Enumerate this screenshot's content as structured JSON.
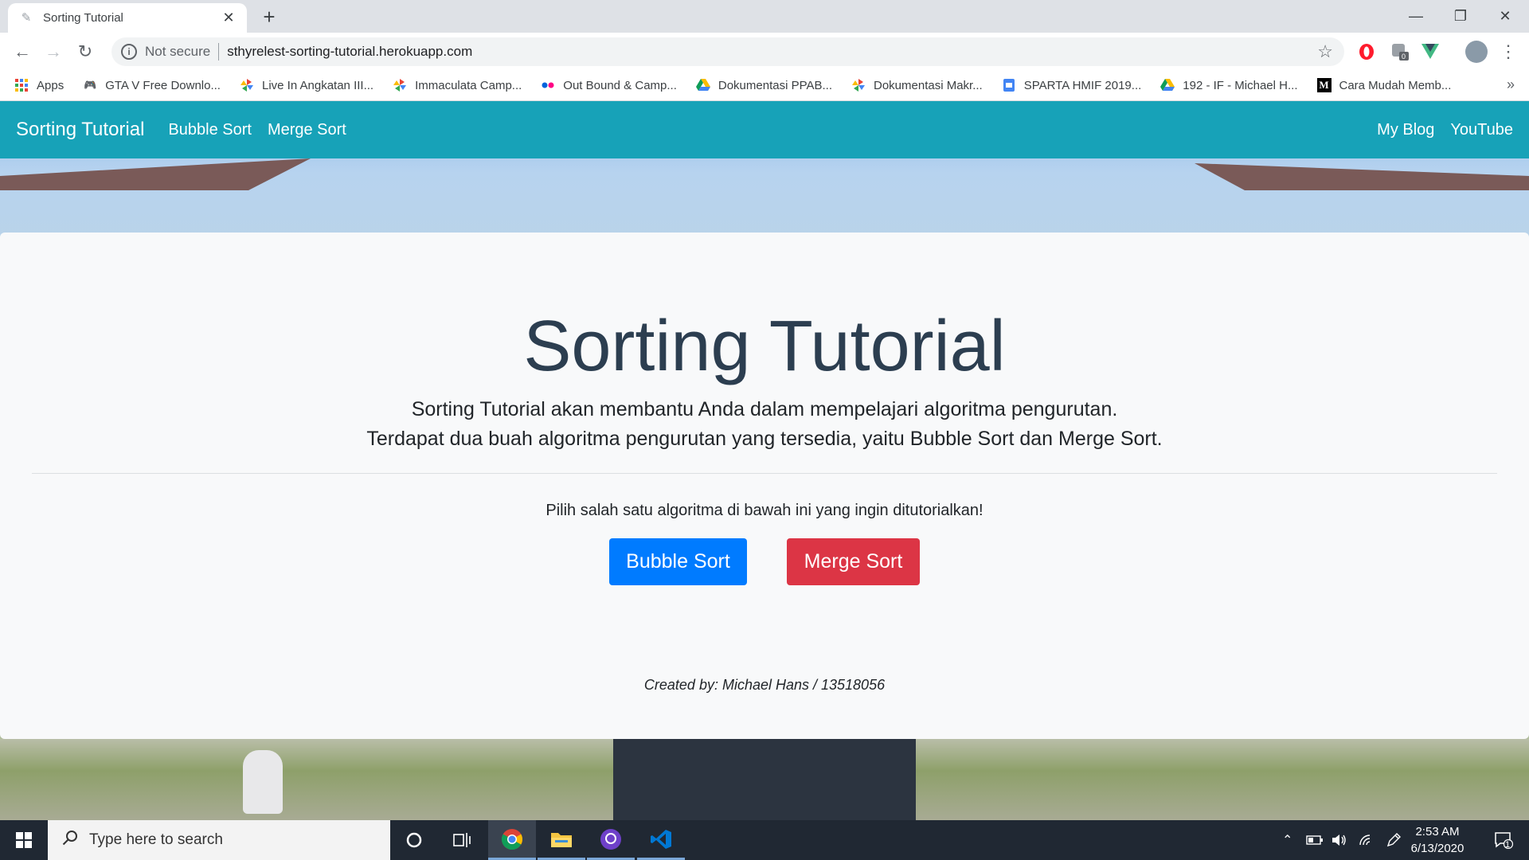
{
  "browser": {
    "tab": {
      "title": "Sorting Tutorial",
      "close": "✕"
    },
    "new_tab": "+",
    "window_controls": {
      "minimize": "—",
      "restore": "❐",
      "close": "✕"
    },
    "toolbar": {
      "back": "←",
      "forward": "→",
      "reload": "↻",
      "info_icon": "i",
      "security_label": "Not secure",
      "url": "sthyrelest-sorting-tutorial.herokuapp.com",
      "bookmark_star": "☆",
      "menu": "⋮"
    },
    "bookmarks": [
      {
        "label": "Apps",
        "icon": "apps-grid-icon",
        "color": "#1a73e8"
      },
      {
        "label": "GTA V Free Downlo...",
        "icon": "gamepad-icon",
        "color": "#c5221f"
      },
      {
        "label": "Live In Angkatan III...",
        "icon": "pinwheel-icon",
        "color": "#ea4335"
      },
      {
        "label": "Immaculata Camp...",
        "icon": "pinwheel-icon",
        "color": "#fbbc04"
      },
      {
        "label": "Out Bound & Camp...",
        "icon": "flickr-dots-icon",
        "color": "#ff0084"
      },
      {
        "label": "Dokumentasi PPAB...",
        "icon": "drive-icon",
        "color": "#0f9d58"
      },
      {
        "label": "Dokumentasi Makr...",
        "icon": "pinwheel-icon",
        "color": "#4285f4"
      },
      {
        "label": "SPARTA HMIF 2019...",
        "icon": "slides-icon",
        "color": "#4285f4"
      },
      {
        "label": "192 - IF - Michael H...",
        "icon": "drive-icon",
        "color": "#fbbc04"
      },
      {
        "label": "Cara Mudah Memb...",
        "icon": "medium-icon",
        "color": "#000000"
      }
    ],
    "bookmarks_more": "»"
  },
  "navbar": {
    "brand": "Sorting Tutorial",
    "links": [
      "Bubble Sort",
      "Merge Sort"
    ],
    "right_links": [
      "My Blog",
      "YouTube"
    ],
    "color": "#17a2b8"
  },
  "hero": {
    "title": "Sorting Tutorial",
    "lead_line1": "Sorting Tutorial akan membantu Anda dalam mempelajari algoritma pengurutan.",
    "lead_line2": "Terdapat dua buah algoritma pengurutan yang tersedia, yaitu Bubble Sort dan Merge Sort.",
    "prompt": "Pilih salah satu algoritma di bawah ini yang ingin ditutorialkan!",
    "button_bubble": "Bubble Sort",
    "button_merge": "Merge Sort",
    "credit": "Created by: Michael Hans / 13518056",
    "colors": {
      "primary": "#007bff",
      "danger": "#dc3545",
      "title": "#2c3e50"
    }
  },
  "taskbar": {
    "search_placeholder": "Type here to search",
    "apps": [
      "cortana-icon",
      "task-view-icon",
      "chrome-icon",
      "file-explorer-icon",
      "github-desktop-icon",
      "vscode-icon"
    ],
    "time": "2:53 AM",
    "date": "6/13/2020",
    "notification_count": "1"
  }
}
